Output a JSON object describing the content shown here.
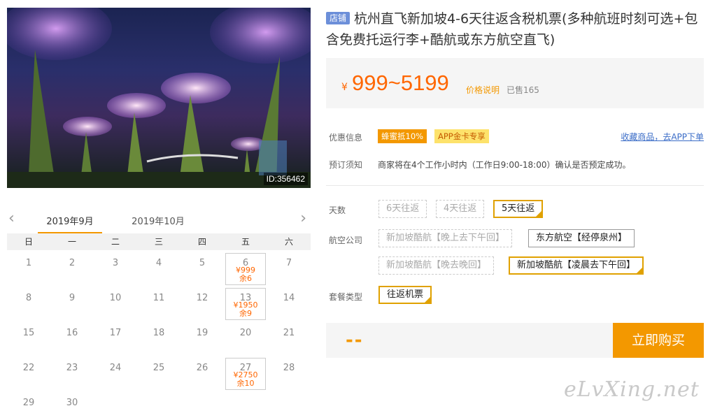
{
  "hero": {
    "id_label": "ID:356462"
  },
  "calendar": {
    "prev_arrow": "‹",
    "next_arrow": "›",
    "months": [
      "2019年9月",
      "2019年10月"
    ],
    "weekdays": [
      "日",
      "一",
      "二",
      "三",
      "四",
      "五",
      "六"
    ],
    "weeks": [
      [
        {
          "d": "1"
        },
        {
          "d": "2"
        },
        {
          "d": "3"
        },
        {
          "d": "4"
        },
        {
          "d": "5"
        },
        {
          "d": "6",
          "price": "¥999",
          "stock": "余6"
        },
        {
          "d": "7"
        }
      ],
      [
        {
          "d": "8"
        },
        {
          "d": "9"
        },
        {
          "d": "10"
        },
        {
          "d": "11"
        },
        {
          "d": "12"
        },
        {
          "d": "13",
          "price": "¥1950",
          "stock": "余9"
        },
        {
          "d": "14"
        }
      ],
      [
        {
          "d": "15"
        },
        {
          "d": "16"
        },
        {
          "d": "17"
        },
        {
          "d": "18"
        },
        {
          "d": "19"
        },
        {
          "d": "20"
        },
        {
          "d": "21"
        }
      ],
      [
        {
          "d": "22"
        },
        {
          "d": "23"
        },
        {
          "d": "24"
        },
        {
          "d": "25"
        },
        {
          "d": "26"
        },
        {
          "d": "27",
          "price": "¥2750",
          "stock": "余10"
        },
        {
          "d": "28"
        }
      ],
      [
        {
          "d": "29"
        },
        {
          "d": "30"
        },
        {
          "d": ""
        },
        {
          "d": ""
        },
        {
          "d": ""
        },
        {
          "d": ""
        },
        {
          "d": ""
        }
      ]
    ]
  },
  "product": {
    "shop_badge": "店铺",
    "title": "杭州直飞新加坡4-6天往返含税机票(多种航班时刻可选+包含免费托运行李+酷航或东方航空直飞)"
  },
  "price": {
    "yen": "¥",
    "range": "999~5199",
    "note": "价格说明",
    "sold": "已售165"
  },
  "promo": {
    "label": "优惠信息",
    "tag1": "蜂蜜抵10%",
    "tag2": "APP金卡专享",
    "collect": "收藏商品，去APP下单"
  },
  "booking": {
    "label": "预订须知",
    "notice": "商家将在4个工作小时内（工作日9:00-18:00）确认是否预定成功。"
  },
  "options": {
    "days_label": "天数",
    "days": [
      "6天往返",
      "4天往返",
      "5天往返"
    ],
    "airline_label": "航空公司",
    "airlines": [
      "新加坡酷航【晚上去下午回】",
      "东方航空【经停泉州】",
      "新加坡酷航【晚去晚回】",
      "新加坡酷航【凌晨去下午回】"
    ],
    "package_label": "套餐类型",
    "packages": [
      "往返机票"
    ]
  },
  "buy": {
    "total": "--",
    "button": "立即购买"
  },
  "watermark": "eLvXing.net",
  "colors": {
    "accent": "#f39800",
    "price": "#ff6600",
    "link": "#3a6cc7"
  }
}
